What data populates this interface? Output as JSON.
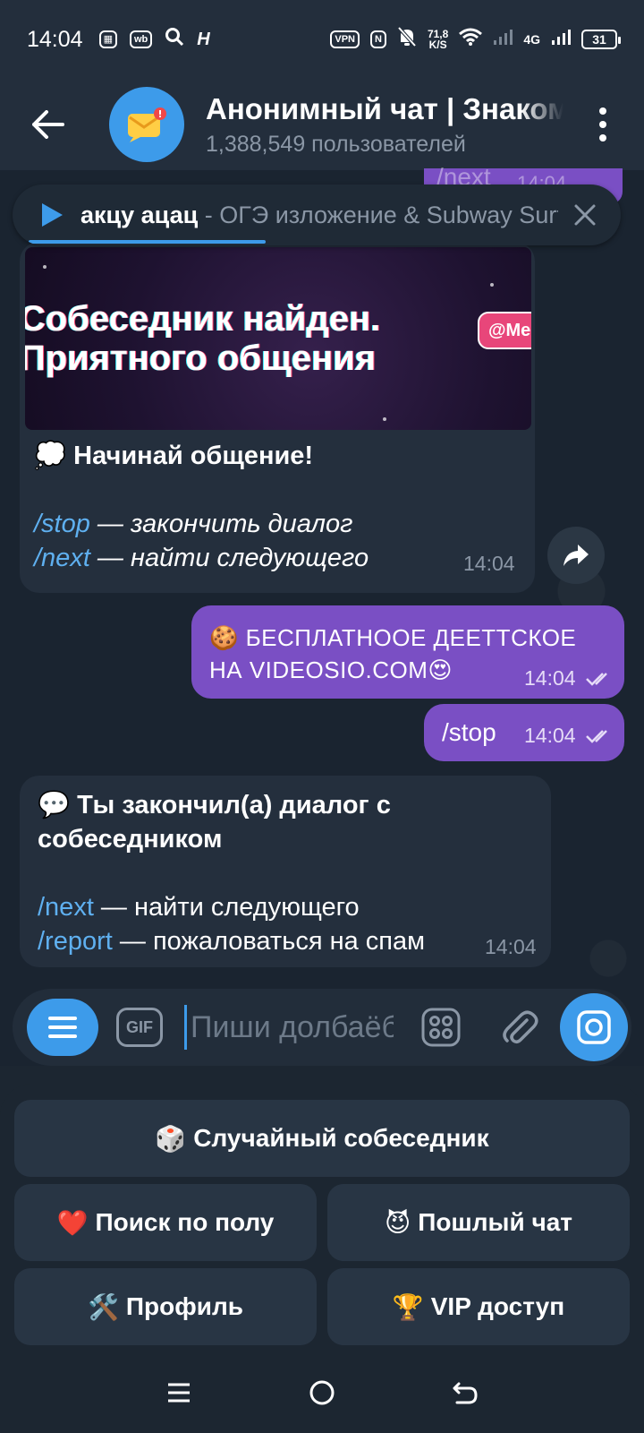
{
  "status_bar": {
    "time": "14:04",
    "net_speed_value": "71,8",
    "net_speed_unit": "K/S",
    "network": "4G",
    "battery": "31",
    "vpn_label": "VPN",
    "wb_label": "wb",
    "nfc_label": "N"
  },
  "header": {
    "title": "Анонимный чат | Знакомства",
    "subtitle": "1,388,549 пользователей"
  },
  "player": {
    "title": "акцу ацац",
    "subtitle": " - ОГЭ изложение & Subway Surfers"
  },
  "messages": {
    "media": {
      "banner_text_line1": "Собеседник найден.",
      "banner_text_line2": "Приятного общения",
      "banner_badge": "@Me",
      "heading_emoji": "💭",
      "heading": "Начинай общение!",
      "cmd1": "/stop",
      "cmd1_desc": " — закончить диалог",
      "cmd2": "/next",
      "cmd2_desc": " — найти следующего",
      "time": "14:04"
    },
    "out1": {
      "text": "🍪 БЕСПЛАТНООЕ ДЕЕТТСКОЕ НА VIDEOSIO.COM😍",
      "time": "14:04"
    },
    "out2": {
      "text": "/stop",
      "time": "14:04"
    },
    "in2": {
      "heading_emoji": "💬",
      "heading": "Ты закончил(а) диалог с собеседником",
      "cmd1": "/next",
      "cmd1_desc": " — найти следующего",
      "cmd2": "/report",
      "cmd2_desc": " — пожаловаться на спам",
      "time": "14:04"
    },
    "peek_text": "/next",
    "peek_time": "14:04"
  },
  "input": {
    "placeholder": "Пиши долбаёбам...",
    "gif_label": "GIF"
  },
  "keyboard": {
    "random": {
      "emoji": "🎲",
      "label": "Случайный собеседник"
    },
    "gender": {
      "emoji": "❤️",
      "label": "Поиск по полу"
    },
    "lewd": {
      "emoji": "😈",
      "label": "Пошлый чат"
    },
    "profile": {
      "emoji": "🛠️",
      "label": "Профиль"
    },
    "vip": {
      "emoji": "🏆",
      "label": "VIP доступ"
    }
  },
  "colors": {
    "accent": "#3d9bea",
    "outgoing_bubble": "#7a4fc4",
    "incoming_bubble": "#242f3d",
    "command_link": "#5fb0f0"
  }
}
